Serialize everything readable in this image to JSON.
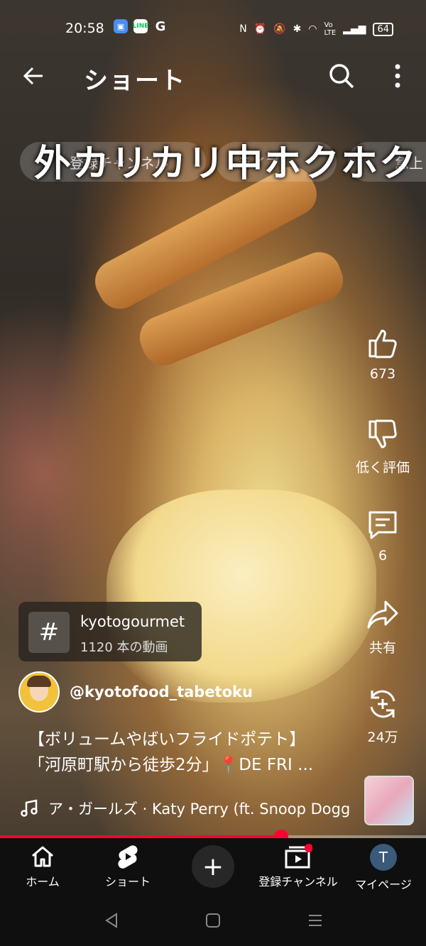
{
  "status_bar": {
    "time": "20:58",
    "app_icons": [
      "G"
    ],
    "battery": "64"
  },
  "topbar": {
    "title": "ショート"
  },
  "chips": [
    {
      "label": "登録チャンネル"
    },
    {
      "label": "ライブ"
    },
    {
      "label": "急上"
    }
  ],
  "overlay_caption": "外カリカリ中ホクホク",
  "actions": {
    "like_count": "673",
    "dislike_label": "低く評価",
    "comment_count": "6",
    "share_label": "共有",
    "remix_count": "24万"
  },
  "hashtag": {
    "symbol": "#",
    "name": "kyotogourmet",
    "video_count": "1120 本の動画"
  },
  "channel": {
    "handle": "@kyotofood_tabetoku"
  },
  "description": {
    "line1": "【ボリュームやばいフライドポテト】",
    "line2": "「河原町駅から徒歩2分」📍DE FRI ..."
  },
  "music": {
    "track": "ア・ガールズ · Katy Perry (ft. Snoop Dogg"
  },
  "progress": {
    "fraction": 0.66
  },
  "bottom_nav": {
    "home": "ホーム",
    "shorts": "ショート",
    "create": "+",
    "subscriptions": "登録チャンネル",
    "mypage": "マイページ",
    "avatar_letter": "T"
  },
  "colors": {
    "accent": "#ff0033",
    "nav_bg": "#0f0f0f"
  }
}
